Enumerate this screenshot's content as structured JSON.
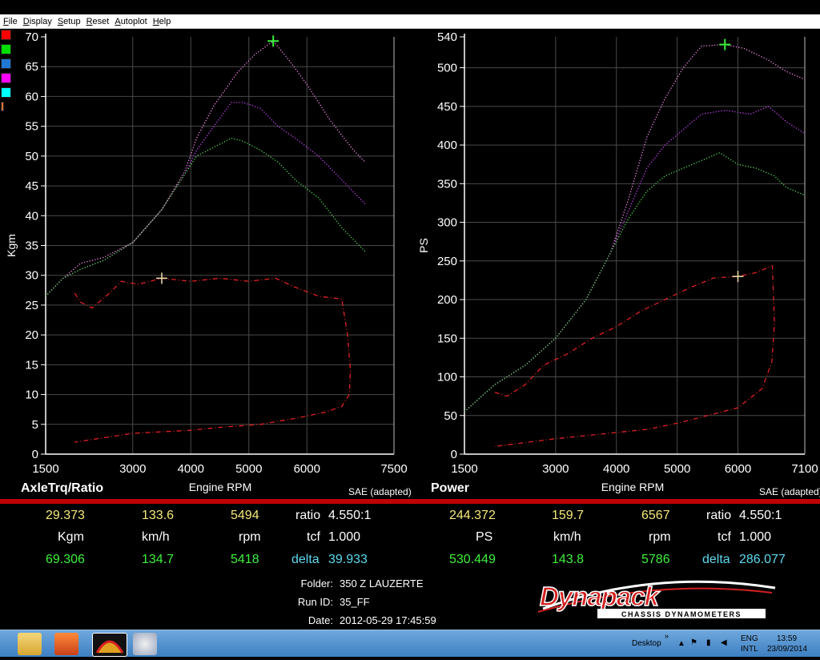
{
  "menu": [
    "File",
    "Display",
    "Setup",
    "Reset",
    "Autoplot",
    "Help"
  ],
  "legend_colors": [
    "#ff0000",
    "#00e000",
    "#1f78d1",
    "#ff00ff",
    "#00ffff",
    "#e07030"
  ],
  "chart_data": [
    {
      "type": "line",
      "title": "AxleTrq/Ratio",
      "xlabel": "Engine RPM",
      "ylabel": "Kgm",
      "note": "SAE (adapted)",
      "xlim": [
        1500,
        7500
      ],
      "ylim": [
        0,
        70
      ],
      "xticks": [
        1500,
        3000,
        4000,
        5000,
        6000,
        7500
      ],
      "yticks": [
        0,
        5,
        10,
        15,
        20,
        25,
        30,
        35,
        40,
        45,
        50,
        55,
        60,
        65,
        70
      ],
      "grid": true,
      "series": [
        {
          "color": "#ff8cf0",
          "style": "dotted",
          "x": [
            1500,
            1800,
            2100,
            2500,
            3000,
            3500,
            3900,
            4100,
            4400,
            4800,
            5100,
            5420,
            5700,
            6000,
            6400,
            6800,
            7000
          ],
          "y": [
            26.5,
            29.5,
            32,
            33,
            35.5,
            41,
            47.5,
            53,
            58.5,
            64,
            67,
            69.3,
            66,
            62,
            56,
            51,
            49
          ]
        },
        {
          "color": "#cc44ff",
          "style": "dotted",
          "x": [
            1500,
            1800,
            2100,
            2500,
            3000,
            3500,
            3900,
            4100,
            4400,
            4700,
            4900,
            5200,
            5500,
            5800,
            6200,
            6600,
            7000
          ],
          "y": [
            26.5,
            29.5,
            31,
            32.5,
            35.5,
            41,
            47,
            51,
            55,
            59,
            59,
            58,
            55,
            53,
            50,
            46,
            42
          ]
        },
        {
          "color": "#55e055",
          "style": "dotted",
          "x": [
            1500,
            1800,
            2100,
            2500,
            3000,
            3500,
            3900,
            4100,
            4400,
            4700,
            4900,
            5200,
            5500,
            5800,
            6200,
            6600,
            7000
          ],
          "y": [
            26.5,
            29.5,
            31,
            32.5,
            35.5,
            41,
            47,
            50,
            51.5,
            53,
            52.5,
            51,
            49,
            46,
            43,
            38,
            34
          ]
        },
        {
          "color": "#e02020",
          "style": "dashed",
          "x": [
            2000,
            2100,
            2300,
            2600,
            2800,
            3100,
            3500,
            4000,
            4500,
            5000,
            5460,
            5800,
            6200,
            6600,
            6700,
            6750,
            6730,
            6600,
            6300,
            5800,
            5200,
            4500,
            4000,
            3000,
            2000
          ],
          "y": [
            27,
            25.5,
            24.5,
            27,
            29,
            28.5,
            29.5,
            29,
            29.5,
            29,
            29.5,
            28,
            26.5,
            26,
            20,
            14,
            10,
            8,
            7,
            6,
            5,
            4.5,
            4,
            3.5,
            2
          ]
        }
      ]
    },
    {
      "type": "line",
      "title": "Power",
      "xlabel": "Engine RPM",
      "ylabel": "PS",
      "note": "SAE (adapted)",
      "xlim": [
        1500,
        7100
      ],
      "ylim": [
        0,
        540
      ],
      "xticks": [
        1500,
        3000,
        4000,
        5000,
        6000,
        7100
      ],
      "yticks": [
        0,
        50,
        100,
        150,
        200,
        250,
        300,
        350,
        400,
        450,
        500,
        540
      ],
      "grid": true,
      "series": [
        {
          "color": "#ff8cf0",
          "style": "dotted",
          "x": [
            1500,
            2000,
            2500,
            3000,
            3500,
            3900,
            4200,
            4500,
            4800,
            5100,
            5400,
            5786,
            6100,
            6500,
            6800,
            7100
          ],
          "y": [
            55,
            90,
            115,
            150,
            200,
            260,
            330,
            410,
            460,
            500,
            528,
            530,
            525,
            510,
            495,
            485
          ]
        },
        {
          "color": "#cc44ff",
          "style": "dotted",
          "x": [
            1500,
            2000,
            2500,
            3000,
            3500,
            3900,
            4200,
            4500,
            4800,
            5100,
            5400,
            5800,
            6200,
            6500,
            6800,
            7100
          ],
          "y": [
            55,
            90,
            115,
            150,
            200,
            260,
            315,
            370,
            400,
            420,
            440,
            445,
            440,
            450,
            430,
            415
          ]
        },
        {
          "color": "#55e055",
          "style": "dotted",
          "x": [
            1500,
            2000,
            2500,
            3000,
            3500,
            3900,
            4200,
            4500,
            4800,
            5100,
            5400,
            5700,
            6000,
            6300,
            6600,
            6800,
            7100
          ],
          "y": [
            55,
            90,
            115,
            150,
            200,
            260,
            305,
            340,
            360,
            370,
            380,
            390,
            375,
            370,
            360,
            345,
            335
          ]
        },
        {
          "color": "#e02020",
          "style": "dashed",
          "x": [
            2000,
            2200,
            2500,
            2800,
            3200,
            3600,
            4000,
            4400,
            4800,
            5200,
            5600,
            6000,
            6300,
            6567,
            6600,
            6560,
            6400,
            6000,
            5500,
            5000,
            4500,
            4000,
            3000,
            2000
          ],
          "y": [
            80,
            75,
            90,
            115,
            130,
            150,
            165,
            185,
            200,
            215,
            228,
            230,
            235,
            244,
            170,
            120,
            85,
            60,
            50,
            40,
            32,
            28,
            20,
            10
          ]
        }
      ]
    }
  ],
  "left_readout": {
    "row1": {
      "value": "29.373",
      "speed": "133.6",
      "rpm": "5494",
      "ratio_label": "ratio",
      "ratio_value": "4.550:1"
    },
    "row2": {
      "unit": "Kgm",
      "speed_unit": "km/h",
      "rpm_unit": "rpm",
      "tcf_label": "tcf",
      "tcf_value": "1.000"
    },
    "row3": {
      "value": "69.306",
      "speed": "134.7",
      "rpm": "5418",
      "delta_label": "delta",
      "delta_value": "39.933"
    }
  },
  "right_readout": {
    "row1": {
      "value": "244.372",
      "speed": "159.7",
      "rpm": "6567",
      "ratio_label": "ratio",
      "ratio_value": "4.550:1"
    },
    "row2": {
      "unit": "PS",
      "speed_unit": "km/h",
      "rpm_unit": "rpm",
      "tcf_label": "tcf",
      "tcf_value": "1.000"
    },
    "row3": {
      "value": "530.449",
      "speed": "143.8",
      "rpm": "5786",
      "delta_label": "delta",
      "delta_value": "286.077"
    }
  },
  "meta": {
    "folder_label": "Folder:",
    "folder_value": "350 Z LAUZERTE",
    "runid_label": "Run ID:",
    "runid_value": "35_FF",
    "date_label": "Date:",
    "date_value": "2012-05-29 17:45:59"
  },
  "logo": {
    "brand": "Dynapack",
    "tagline": "CHASSIS DYNAMOMETERS",
    "brand_color": "#d42020"
  },
  "taskbar": {
    "desktop_label": "Desktop",
    "lang1": "ENG",
    "lang2": "INTL",
    "time": "13:59",
    "date": "23/09/2014"
  }
}
